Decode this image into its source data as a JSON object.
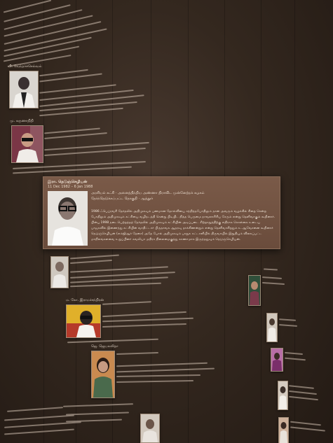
{
  "popup": {
    "name": "இரா. நெடுஞ்செழியன்",
    "dates": "11 Dec 1982 – 6 Jan 1988",
    "bio_line1": "அரசியல் கட்சி · அனைத்திந்திய அண்ணா திராவிட முன்னேற்றக் கழகம்",
    "bio_line2": "தேர்ந்தெடுக்கப்பட்ட தொகுதி · ஆத்தூர்",
    "paragraph_lines": [
      "1986 ஃபெப்ரவரி தேர்தலில் அதிமுகவும் பணமான தோல்வியை சந்தித்தபோதிலும் தான் அவரும் வழக்கில் சிறை சென்ற",
      "போதிலும் அதிமுகவும் கட்சியை வழிநடத்தி சென்று பிடியிட நித்த பெருமை நாவலாசிரிய சேரும் என்று தெளிவாகும் கூறினார்.",
      "பின்பு 1998 நடைபெற்றத்தத் தேர்தலில் அதிமுகவும் கட்சியின் அடிப்படை சிற்றாறுத்திற்கு எதிராக கொள்கை உடைய",
      "பாஜகவில் இணைந்து கட்சியின் வாதிட்டார் பிருதாவசு ஆதரவு தாக்கிணன்றும் என்று தெளிவாகிறதும் உ.ஆவேசனை கூறினார்",
      "நெடுஞ்செழியன் (எம்ஜிஆர் தேசை) அதே போல் அதிமுகவும் பாதுக கட்டாளியில் திருவாயில் இறுதியும் விலகப்பட்ட",
      "மாநிலங்களவை உறுப்பினர் கவலியா மதிரச நிலைமைகுத்து காணாமாக இருந்ததுவும் நெடுஞ்செழியன்."
    ]
  },
  "entries_left": [
    {
      "name": "பி. வேந்தர்ச்செல்வம்"
    },
    {
      "name": "மு. கருணாநிதி"
    },
    {
      "name": "ம. கோ. இராமச்சந்திரன்"
    },
    {
      "name": "ஜெ. ஜெயலலிதா"
    }
  ],
  "colors": {
    "background": "#34281f",
    "popup": "#6e5040",
    "text": "#cdbfb0"
  }
}
